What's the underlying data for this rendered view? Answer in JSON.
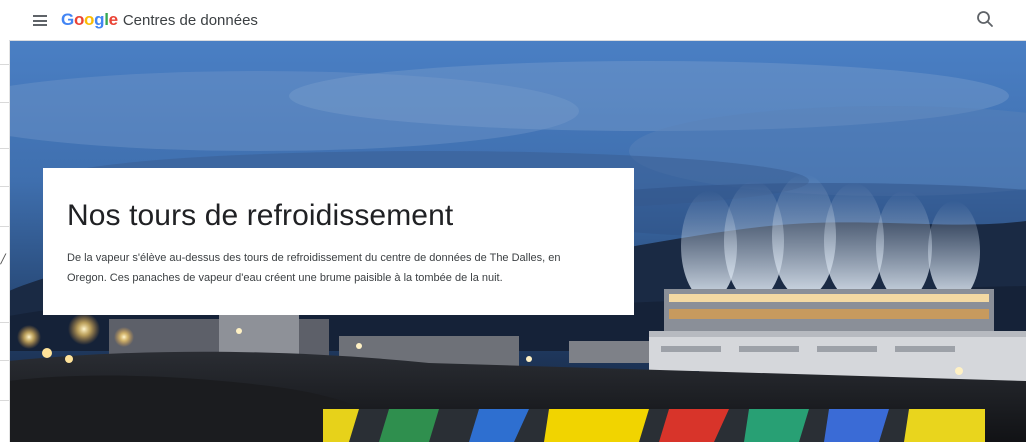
{
  "header": {
    "menu_icon": "menu-icon",
    "logo_letters": [
      "G",
      "o",
      "o",
      "g",
      "l",
      "e"
    ],
    "title": "Centres de données",
    "search_icon": "search-icon"
  },
  "hero": {
    "title": "Nos tours de refroidissement",
    "description": "De la vapeur s'élève au-dessus des tours de refroidissement du centre de données de The Dalles, en Oregon. Ces panaches de vapeur d'eau créent une brume paisible à la tombée de la nuit."
  },
  "left_strip": {
    "glyph": "/"
  },
  "colors": {
    "google_blue": "#4285f4",
    "google_red": "#ea4335",
    "google_yellow": "#fbbc05",
    "google_green": "#34a853",
    "header_border": "#dadce0"
  }
}
